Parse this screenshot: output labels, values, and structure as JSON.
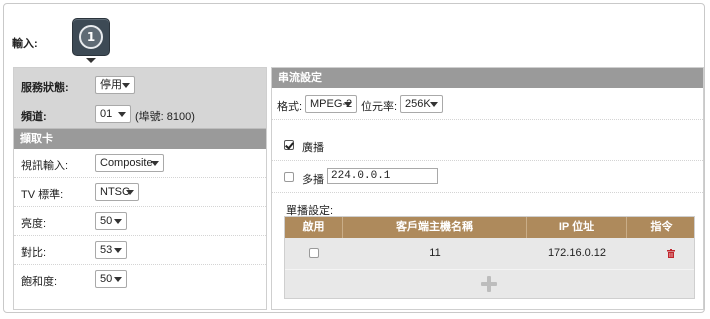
{
  "input": {
    "label": "輸入:",
    "number": "1"
  },
  "service": {
    "status_label": "服務狀態:",
    "status_value": "停用",
    "channel_label": "頻道:",
    "channel_value": "01",
    "port_hint": "(埠號: 8100)"
  },
  "capture_card": {
    "title": "擷取卡",
    "rows": [
      {
        "label": "視訊輸入:",
        "value": "Composite"
      },
      {
        "label": "TV 標準:",
        "value": "NTSC"
      },
      {
        "label": "亮度:",
        "value": "50"
      },
      {
        "label": "對比:",
        "value": "53"
      },
      {
        "label": "飽和度:",
        "value": "50"
      }
    ]
  },
  "streaming": {
    "title": "串流設定",
    "format_label": "格式:",
    "format_value": "MPEG-2",
    "bitrate_label": "位元率:",
    "bitrate_value": "256K",
    "broadcast_label": "廣播",
    "broadcast_checked": true,
    "multicast_label": "多播",
    "multicast_checked": false,
    "multicast_address": "224.0.0.1",
    "unicast_label": "單播設定:",
    "table": {
      "headers": [
        "啟用",
        "客戶端主機名稱",
        "IP 位址",
        "指令"
      ],
      "rows": [
        {
          "enabled": false,
          "hostname": "11",
          "ip": "172.16.0.12"
        }
      ]
    }
  },
  "colors": {
    "section_header": "#9a9a9a",
    "table_header": "#ae8a5c",
    "status_block": "#d6d6d6",
    "delete_icon": "#c0262d"
  }
}
